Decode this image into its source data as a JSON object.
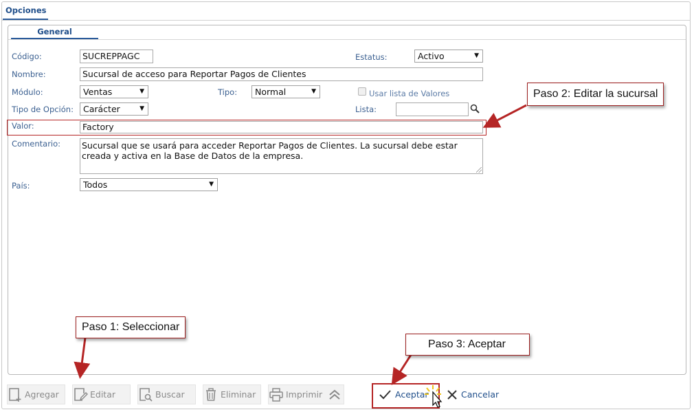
{
  "tabs": {
    "top": "Opciones",
    "inner": "General"
  },
  "labels": {
    "codigo": "Código:",
    "estatus": "Estatus:",
    "nombre": "Nombre:",
    "modulo": "Módulo:",
    "tipo": "Tipo:",
    "usar_lista": "Usar lista de Valores",
    "tipo_opcion": "Tipo de Opción:",
    "lista": "Lista:",
    "valor": "Valor:",
    "comentario": "Comentario:",
    "pais": "País:"
  },
  "fields": {
    "codigo": "SUCREPPAGC",
    "estatus": "Activo",
    "nombre": "Sucursal de acceso para Reportar Pagos de Clientes",
    "modulo": "Ventas",
    "tipo": "Normal",
    "tipo_opcion": "Carácter",
    "lista": "",
    "valor": "Factory",
    "comentario": "Sucursal que se usará para acceder Reportar Pagos de Clientes. La sucursal debe estar creada y activa en la Base de Datos de la empresa.",
    "pais": "Todos",
    "usar_lista_checked": false
  },
  "callouts": {
    "paso1": "Paso 1: Seleccionar",
    "paso2": "Paso 2: Editar la sucursal",
    "paso3": "Paso 3: Aceptar"
  },
  "toolbar": {
    "agregar": "Agregar",
    "editar": "Editar",
    "buscar": "Buscar",
    "eliminar": "Eliminar",
    "imprimir": "Imprimir",
    "aceptar": "Aceptar",
    "cancelar": "Cancelar"
  },
  "colors": {
    "accent": "#1f4e8a",
    "label": "#3a5f90",
    "annotation": "#b52525",
    "disabled": "#8a8a8a"
  }
}
